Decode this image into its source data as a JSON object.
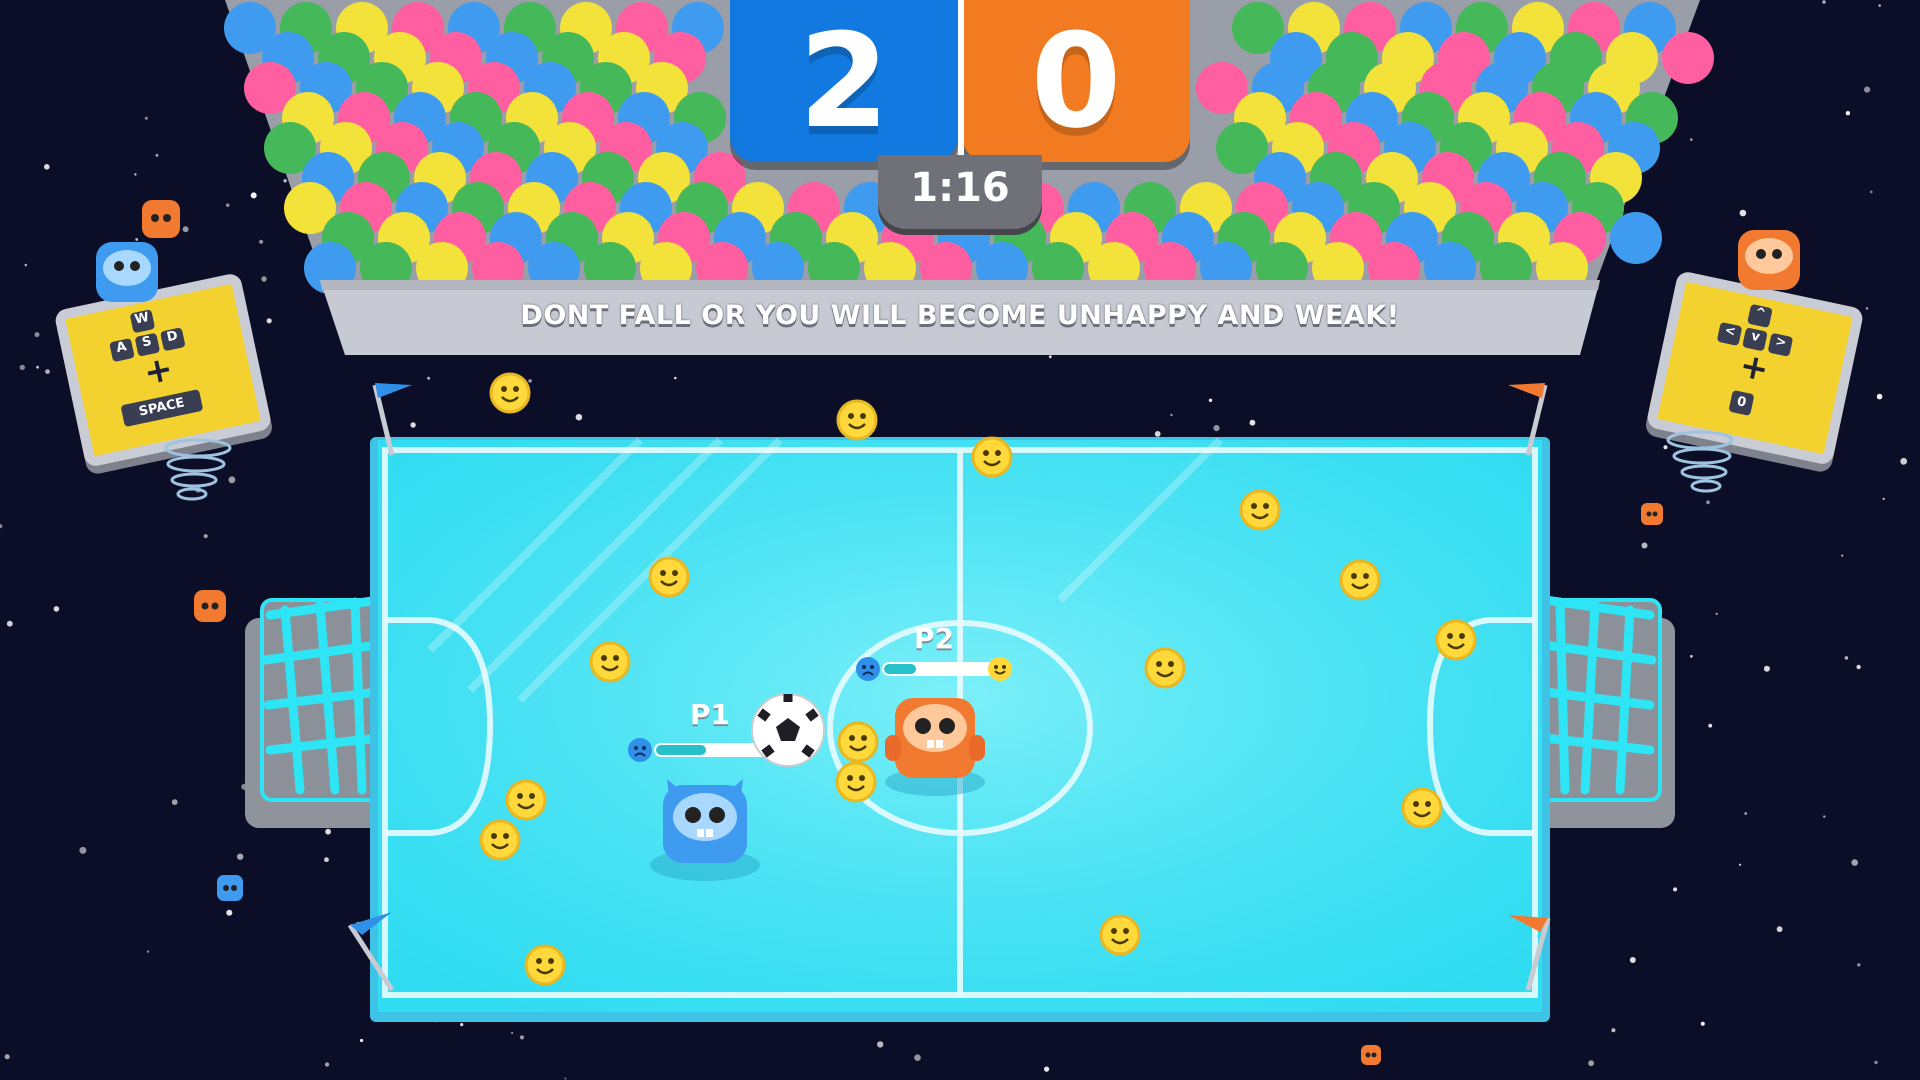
{
  "scoreboard": {
    "team_blue_score": "2",
    "team_orange_score": "0",
    "timer": "1:16",
    "blue_color": "#1279e0",
    "orange_color": "#f27a20"
  },
  "banner": {
    "message": "DONT FALL OR YOU WILL BECOME UNHAPPY AND WEAK!"
  },
  "players": [
    {
      "label": "P1",
      "color": "#3f9bf0",
      "mood_icon": "sad-face-icon",
      "happiness": 0.4
    },
    {
      "label": "P2",
      "color": "#f27a30",
      "mood_icon": "sad-face-icon",
      "happiness": 0.3
    }
  ],
  "controls": {
    "p1": {
      "keys": [
        "W",
        "A",
        "S",
        "D"
      ],
      "plus": "+",
      "action": "SPACE"
    },
    "p2": {
      "keys": [
        "^",
        "<",
        "v",
        ">"
      ],
      "plus": "+",
      "action": "0"
    }
  },
  "colors": {
    "field": "#33dff2",
    "space": "#0b0e26",
    "smiley": "#ffd93b"
  }
}
